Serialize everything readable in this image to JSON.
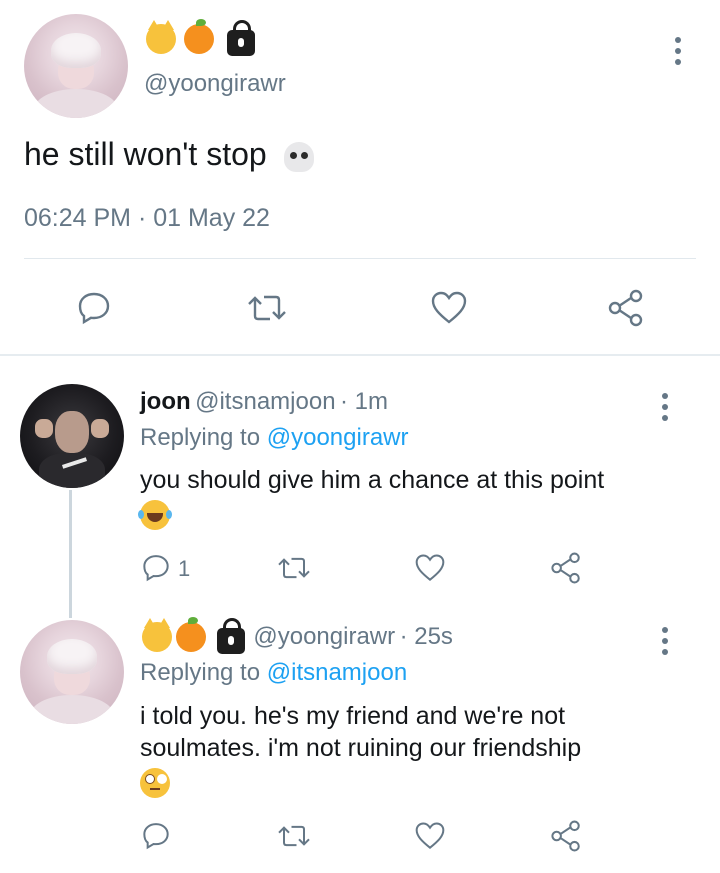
{
  "main_tweet": {
    "username": "@yoongirawr",
    "name_emojis": [
      "cat-face-emoji",
      "tangerine-emoji",
      "lock-emoji"
    ],
    "text": "he still won't stop",
    "text_emoji": "skull-emoji",
    "timestamp": "06:24 PM · 01 May 22"
  },
  "replies": [
    {
      "display_name": "joon",
      "handle": "@itsnamjoon",
      "time": "· 1m",
      "replying_prefix": "Replying to",
      "replying_to": "@yoongirawr",
      "text": "you should give him a chance at this point",
      "text_emoji": "tears-of-joy-emoji",
      "reply_count": "1"
    },
    {
      "name_emojis": [
        "cat-face-emoji",
        "tangerine-emoji",
        "lock-emoji"
      ],
      "handle": "@yoongirawr",
      "time": "· 25s",
      "replying_prefix": "Replying to",
      "replying_to": "@itsnamjoon",
      "text_line1": "i told you. he's my friend and we're not",
      "text_line2": "soulmates. i'm not ruining our friendship",
      "text_emoji": "eye-roll-emoji"
    }
  ],
  "colors": {
    "link": "#1da1f2",
    "muted": "#657786",
    "text": "#14171a",
    "divider": "#e1e8ed"
  }
}
